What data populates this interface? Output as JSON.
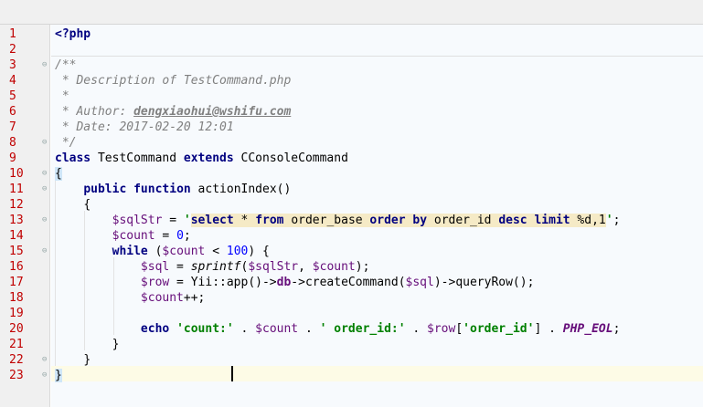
{
  "editor": {
    "lines": [
      {
        "n": "1",
        "text": "<?php"
      },
      {
        "n": "2",
        "text": ""
      },
      {
        "n": "3",
        "text": "/**"
      },
      {
        "n": "4",
        "text": " * Description of TestCommand.php"
      },
      {
        "n": "5",
        "text": " *"
      },
      {
        "n": "6",
        "text": " * Author: dengxiaohui@wshifu.com"
      },
      {
        "n": "7",
        "text": " * Date: 2017-02-20 12:01"
      },
      {
        "n": "8",
        "text": " */"
      },
      {
        "n": "9",
        "text": "class TestCommand extends CConsoleCommand"
      },
      {
        "n": "10",
        "text": "{"
      },
      {
        "n": "11",
        "text": "    public function actionIndex()"
      },
      {
        "n": "12",
        "text": "    {"
      },
      {
        "n": "13",
        "text": "        $sqlStr = 'select * from order_base order by order_id desc limit %d,1';"
      },
      {
        "n": "14",
        "text": "        $count = 0;"
      },
      {
        "n": "15",
        "text": "        while ($count < 100) {"
      },
      {
        "n": "16",
        "text": "            $sql = sprintf($sqlStr, $count);"
      },
      {
        "n": "17",
        "text": "            $row = Yii::app()->db->createCommand($sql)->queryRow();"
      },
      {
        "n": "18",
        "text": "            $count++;"
      },
      {
        "n": "19",
        "text": ""
      },
      {
        "n": "20",
        "text": "            echo 'count:' . $count . ' order_id:' . $row['order_id'] . PHP_EOL;"
      },
      {
        "n": "21",
        "text": "        }"
      },
      {
        "n": "22",
        "text": "    }"
      },
      {
        "n": "23",
        "text": "}"
      }
    ],
    "tokens": {
      "php_open": "<?php",
      "doc_open": "/**",
      "desc": " * Description of TestCommand.php",
      "star": " *",
      "author_label": " * Author: ",
      "author_email": "dengxiaohui@wshifu.com",
      "date": " * Date: 2017-02-20 12:01",
      "doc_close": " */",
      "kw_class": "class",
      "class_name": " TestCommand ",
      "kw_extends": "extends",
      "parent_class": " CConsoleCommand",
      "brace_open": "{",
      "brace_close": "}",
      "kw_public": "public",
      "kw_function": "function",
      "method_name": " actionIndex()",
      "var_sqlStr": "$sqlStr",
      "assign": " = ",
      "sql_quote_open": "'",
      "sql_select": "select",
      "sql_star": " * ",
      "sql_from": "from",
      "sql_table": " order_base ",
      "sql_order": "order",
      "sql_by": "by",
      "sql_col": " order_id ",
      "sql_desc": "desc",
      "sql_limit": "limit",
      "sql_tail": " %d,1",
      "sql_quote_close": "'",
      "semicolon": ";",
      "var_count": "$count",
      "num_zero": "0",
      "kw_while": "while",
      "lt": " < ",
      "num_hundred": "100",
      "var_sql": "$sql",
      "fn_sprintf": "sprintf",
      "var_row": "$row",
      "yii": "Yii::app()->",
      "prop_db": "db",
      "create_cmd": "->createCommand(",
      "query_row": ")->queryRow();",
      "incr": "++;",
      "kw_echo": "echo",
      "str_count": "'count:'",
      "str_order_id": "' order_id:'",
      "str_key": "'order_id'",
      "const_eol": "PHP_EOL"
    }
  }
}
